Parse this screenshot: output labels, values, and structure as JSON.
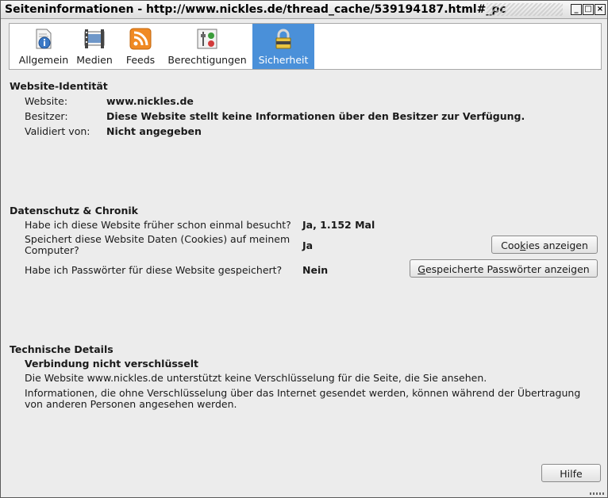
{
  "window": {
    "title": "Seiteninformationen - http://www.nickles.de/thread_cache/539194187.html#_pc",
    "controls": {
      "minimize": "_",
      "maximize": "□",
      "close": "×"
    }
  },
  "tabs": [
    {
      "label": "Allgemein",
      "icon": "info-page-icon"
    },
    {
      "label": "Medien",
      "icon": "media-film-icon"
    },
    {
      "label": "Feeds",
      "icon": "rss-feed-icon"
    },
    {
      "label": "Berechtigungen",
      "icon": "permissions-icon"
    },
    {
      "label": "Sicherheit",
      "icon": "padlock-icon",
      "active": true
    }
  ],
  "identity": {
    "heading": "Website-Identität",
    "website_label": "Website:",
    "website_value": "www.nickles.de",
    "owner_label": "Besitzer:",
    "owner_value": "Diese Website stellt keine Informationen über den Besitzer zur Verfügung.",
    "verified_label": "Validiert von:",
    "verified_value": "Nicht angegeben"
  },
  "privacy": {
    "heading": "Datenschutz & Chronik",
    "visited_q": "Habe ich diese Website früher schon einmal besucht?",
    "visited_a": "Ja, 1.152 Mal",
    "cookies_q": "Speichert diese Website Daten (Cookies) auf meinem Computer?",
    "cookies_a": "Ja",
    "cookies_btn_pre": "Coo",
    "cookies_btn_ul": "k",
    "cookies_btn_post": "ies anzeigen",
    "passwords_q": "Habe ich Passwörter für diese Website gespeichert?",
    "passwords_a": "Nein",
    "passwords_btn_ul": "G",
    "passwords_btn_post": "espeicherte Passwörter anzeigen"
  },
  "technical": {
    "heading": "Technische Details",
    "status": "Verbindung nicht verschlüsselt",
    "line1": "Die Website www.nickles.de unterstützt keine Verschlüsselung für die Seite, die Sie ansehen.",
    "line2": "Informationen, die ohne Verschlüsselung über das Internet gesendet werden, können während der Übertragung von anderen Personen angesehen werden."
  },
  "help_btn": "Hilfe",
  "colors": {
    "active_tab": "#4a90d9",
    "background": "#ececec"
  }
}
